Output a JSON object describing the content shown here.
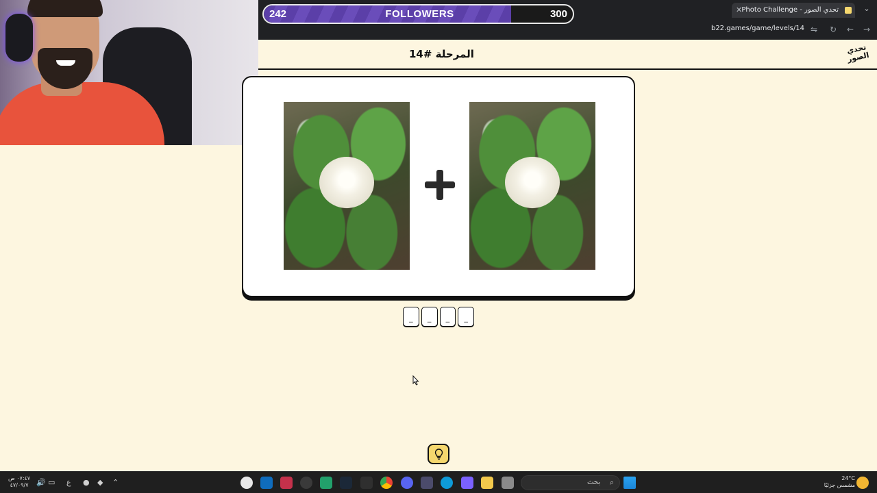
{
  "browser": {
    "tab_title": "Photo Challenge - تحدي الصور",
    "tab_close": "✕",
    "new_tab": "+",
    "tab_list": "⌄",
    "url": "b22.games/game/levels/14",
    "back": "←",
    "forward": "→",
    "reload": "↻",
    "tune": "⇋"
  },
  "followers": {
    "current": "242",
    "label": "FOLLOWERS",
    "goal": "300",
    "progress": 0.8
  },
  "game": {
    "level_title": "المرحلة #14",
    "logo_text": "تحدي الصور",
    "slots": [
      "_",
      "_",
      "_",
      "_"
    ]
  },
  "taskbar": {
    "time": "٠٧:٤٧ ص",
    "date": "٤٧/٠٩/٧",
    "lang": "ع",
    "search_placeholder": "بحث",
    "temperature": "24°C",
    "weather": "مشمس جزئيًا"
  },
  "colors": {
    "page_bg": "#fdf6e0",
    "followers_fill": "#5b3fa8",
    "hint_bg": "#f5d76e",
    "chrome_bg": "#202124"
  }
}
